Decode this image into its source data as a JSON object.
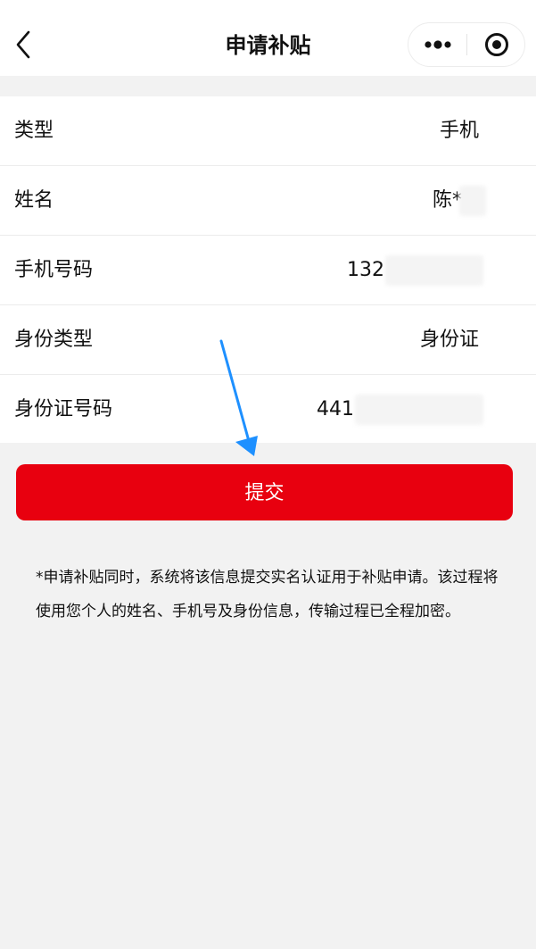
{
  "nav": {
    "title": "申请补贴",
    "back_icon": "chevron-left-icon",
    "more_icon": "more-dots-icon",
    "close_icon": "target-close-icon"
  },
  "form": {
    "rows": [
      {
        "label": "类型",
        "value": "手机"
      },
      {
        "label": "姓名",
        "value": "陈*"
      },
      {
        "label": "手机号码",
        "value": "132"
      },
      {
        "label": "身份类型",
        "value": "身份证"
      },
      {
        "label": "身份证号码",
        "value": "441"
      }
    ]
  },
  "submit": {
    "label": "提交"
  },
  "notice": {
    "text": "*申请补贴同时，系统将该信息提交实名认证用于补贴申请。该过程将使用您个人的姓名、手机号及身份信息，传输过程已全程加密。"
  },
  "colors": {
    "accent": "#e8000f",
    "annotation_arrow": "#1e90ff",
    "background": "#f2f2f2"
  }
}
